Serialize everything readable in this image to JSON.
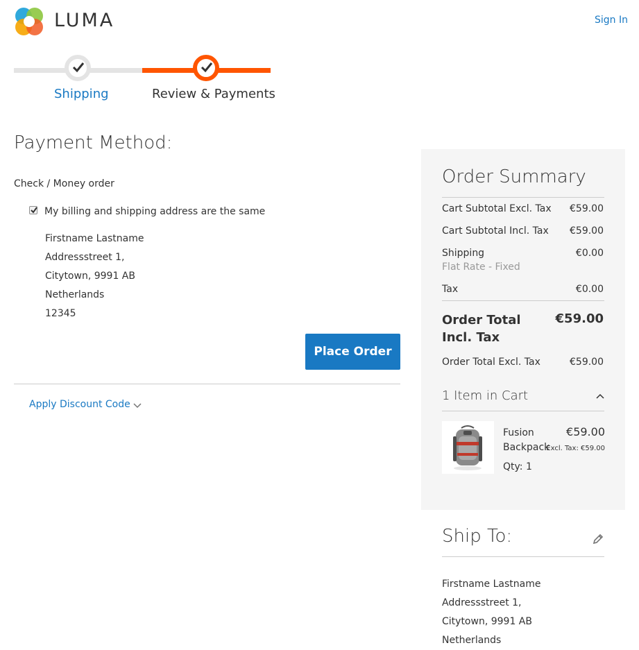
{
  "header": {
    "logo_text": "LUMA",
    "sign_in": "Sign In"
  },
  "progress": {
    "steps": [
      {
        "label": "Shipping",
        "state": "complete"
      },
      {
        "label": "Review & Payments",
        "state": "active"
      }
    ],
    "colors": {
      "active": "#ff5501",
      "inactive": "#e4e4e4",
      "link": "#1979c3"
    }
  },
  "payment": {
    "title": "Payment Method:",
    "method_name": "Check / Money order",
    "same_address_label": "My billing and shipping address are the same",
    "same_address_checked": true,
    "billing_address": [
      "Firstname Lastname",
      "Addressstreet 1,",
      "Citytown, 9991 AB",
      "Netherlands",
      "12345"
    ],
    "place_order_label": "Place Order",
    "discount_label": "Apply Discount Code"
  },
  "summary": {
    "title": "Order Summary",
    "rows": {
      "subtotal_excl": {
        "label": "Cart Subtotal Excl. Tax",
        "value": "€59.00"
      },
      "subtotal_incl": {
        "label": "Cart Subtotal Incl. Tax",
        "value": "€59.00"
      },
      "shipping": {
        "label": "Shipping",
        "sub": "Flat Rate - Fixed",
        "value": "€0.00"
      },
      "tax": {
        "label": "Tax",
        "value": "€0.00"
      }
    },
    "grand_total": {
      "label": "Order Total Incl. Tax",
      "value": "€59.00"
    },
    "total_excl": {
      "label": "Order Total Excl. Tax",
      "value": "€59.00"
    },
    "items_toggle": "1 Item in Cart",
    "item": {
      "name": "Fusion Backpack",
      "price": "€59.00",
      "excl_tax": "Excl. Tax: €59.00",
      "qty": "Qty: 1"
    }
  },
  "ship_to": {
    "title": "Ship To:",
    "address": [
      "Firstname Lastname",
      "Addressstreet 1,",
      "Citytown, 9991 AB",
      "Netherlands"
    ]
  }
}
